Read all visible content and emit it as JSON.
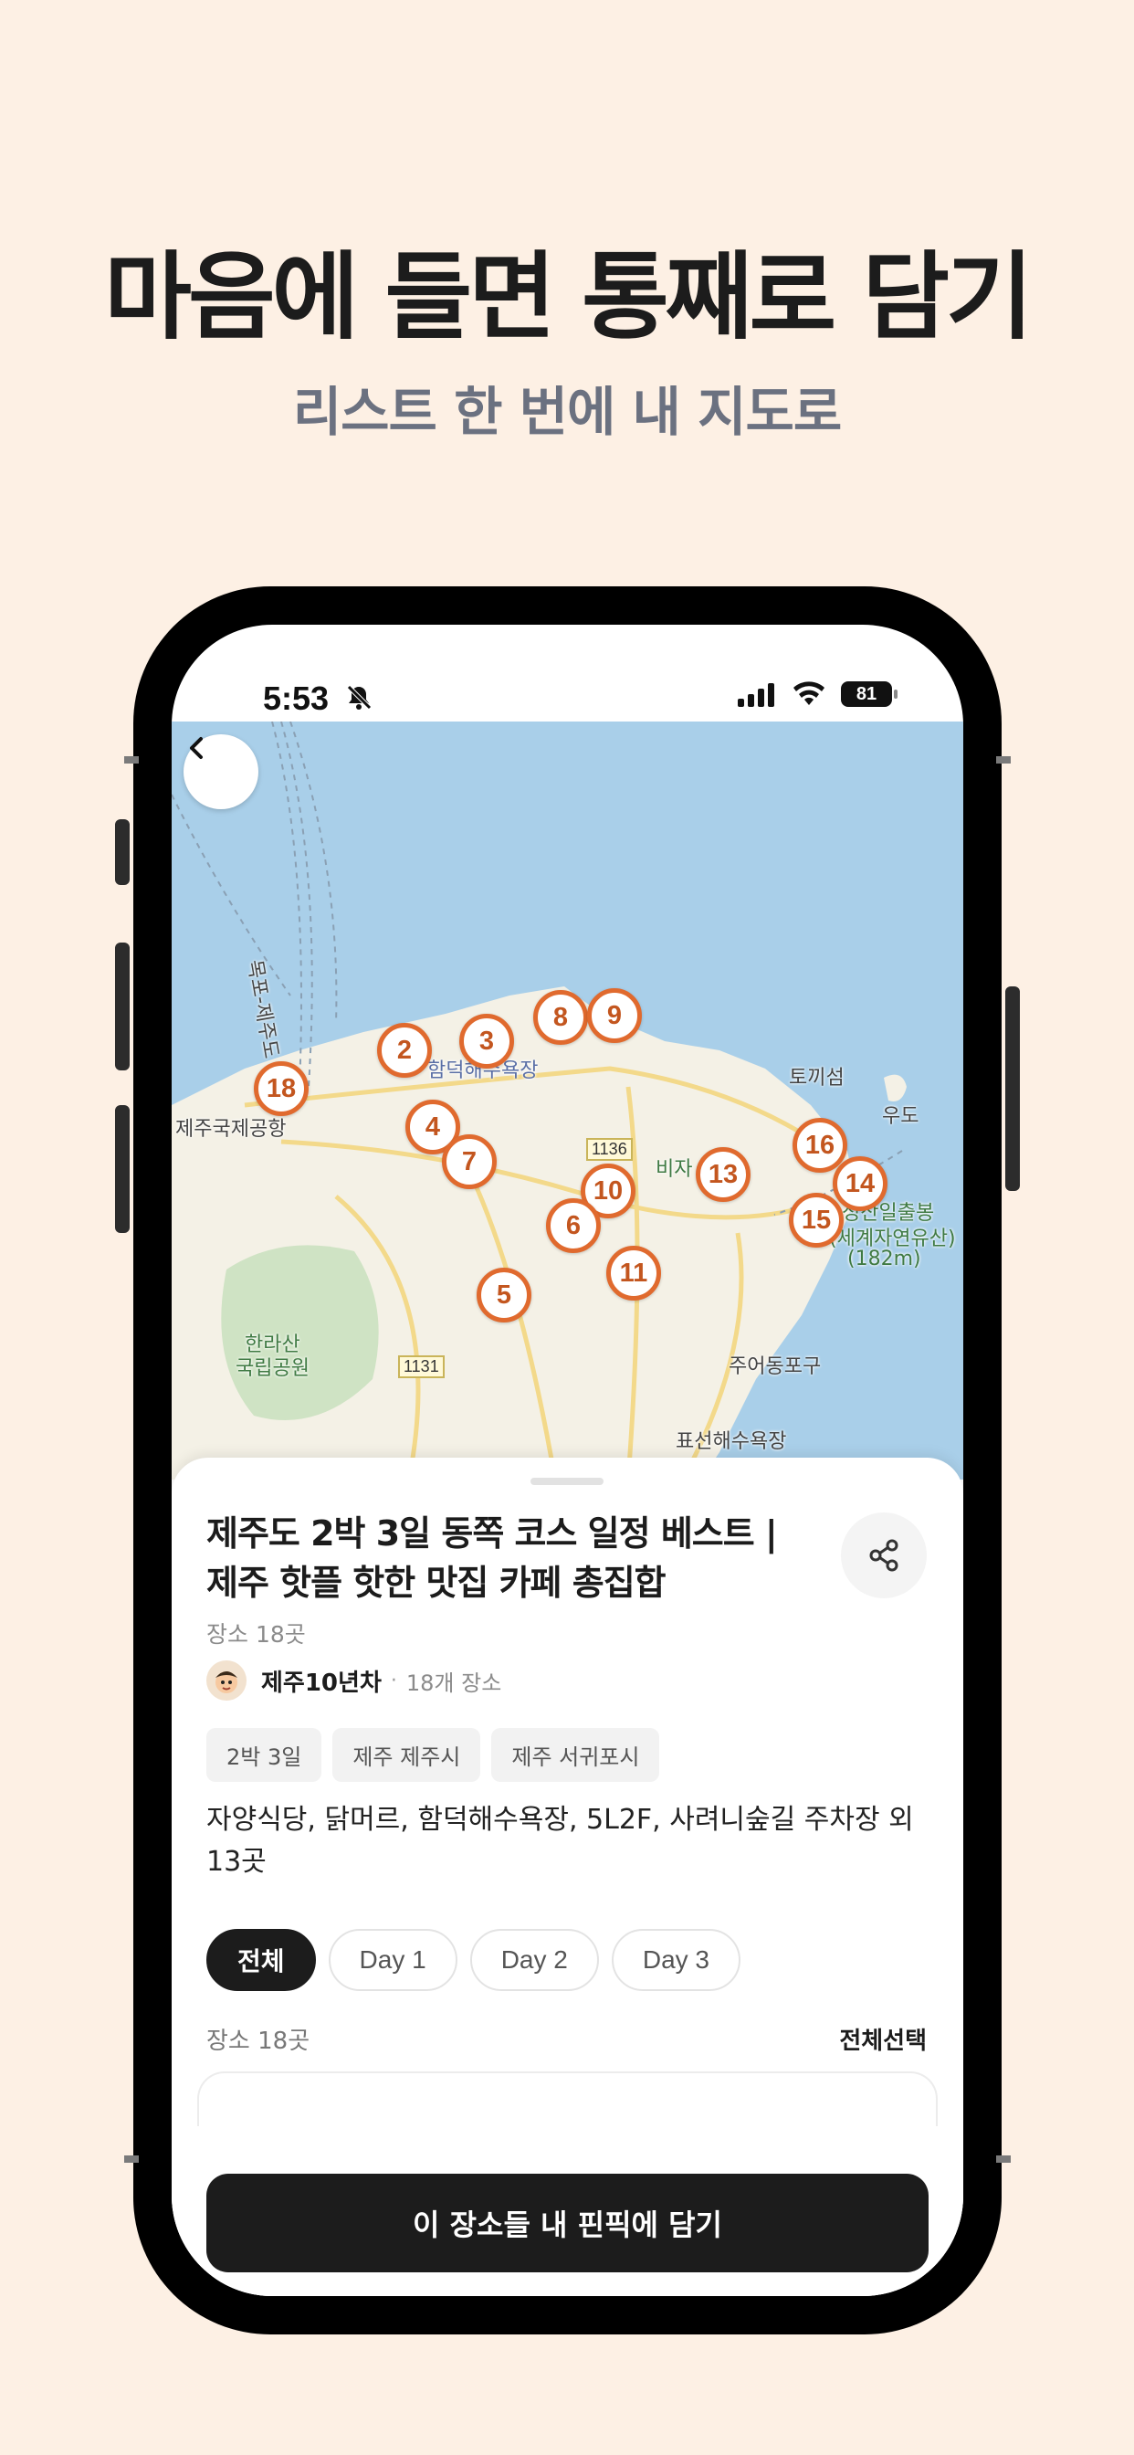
{
  "promo": {
    "headline": "마음에 들면 통째로 담기",
    "subhead": "리스트 한 번에 내 지도로"
  },
  "status_bar": {
    "time": "5:53",
    "battery": "81"
  },
  "map": {
    "labels": {
      "airport": "제주국제공항",
      "beach_hamdeok": "함덕해수욕장",
      "tokkiseom": "토끼섬",
      "udo": "우도",
      "bija": "비자",
      "seongsan": "성산일출봉",
      "seongsan_2": "(세계자연유산)",
      "seongsan_3": "(182m)",
      "hallasan": "한라산",
      "hallasan_2": "국립공원",
      "jueodong": "주어동포구",
      "pyoseon": "표선해수욕장",
      "ferry": "목포-제주도",
      "road_1136": "1136",
      "road_1131": "1131"
    },
    "pins": [
      "2",
      "3",
      "8",
      "9",
      "18",
      "4",
      "7",
      "16",
      "10",
      "13",
      "14",
      "6",
      "15",
      "11",
      "5"
    ]
  },
  "sheet": {
    "title": "제주도 2박 3일 동쪽 코스 일정 베스트 | 제주 핫플 핫한 맛집 카페 총집합",
    "place_count": "장소 18곳",
    "author_name": "제주10년차",
    "author_sep": "·",
    "author_meta": "18개 장소",
    "tags": [
      "2박 3일",
      "제주 제주시",
      "제주 서귀포시"
    ],
    "description": "자양식당, 닭머르, 함덕해수욕장, 5L2F, 사려니숲길 주차장 외 13곳",
    "day_tabs": [
      "전체",
      "Day 1",
      "Day 2",
      "Day 3"
    ],
    "list_label": "장소 18곳",
    "select_all": "전체선택",
    "cta": "이 장소들 내 핀픽에 담기"
  }
}
